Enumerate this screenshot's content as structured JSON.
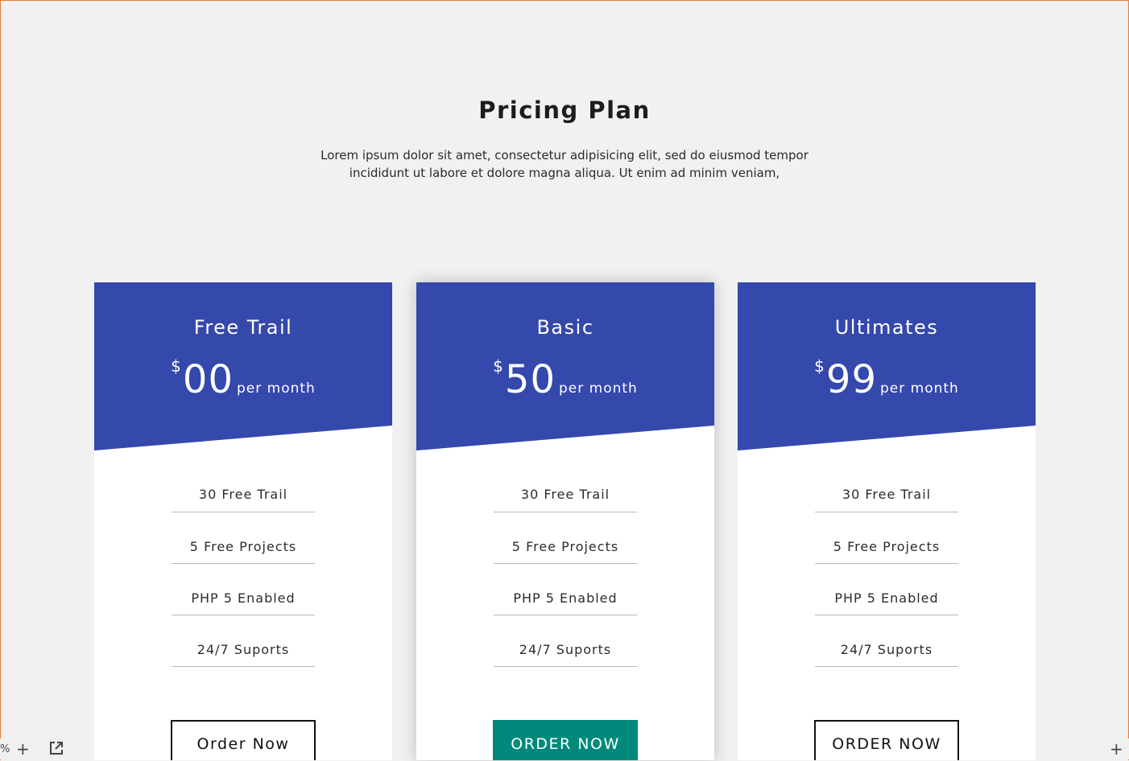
{
  "section": {
    "title": "Pricing Plan",
    "description": "Lorem ipsum dolor sit amet, consectetur adipisicing elit, sed do eiusmod tempor incididunt ut labore et dolore magna aliqua. Ut enim ad minim veniam,"
  },
  "colors": {
    "header_blue": "#3548ac",
    "accent_teal": "#00897b",
    "background": "#f0f1f0",
    "frame_orange": "#e87a3a"
  },
  "plans": [
    {
      "name": "Free Trail",
      "currency": "$",
      "amount": "00",
      "period": "per month",
      "features": [
        "30 Free Trail",
        "5 Free Projects",
        "PHP 5 Enabled",
        "24/7 Suports"
      ],
      "button": "Order Now",
      "featured": false
    },
    {
      "name": "Basic",
      "currency": "$",
      "amount": "50",
      "period": "per month",
      "features": [
        "30 Free Trail",
        "5 Free Projects",
        "PHP 5 Enabled",
        "24/7 Suports"
      ],
      "button": "ORDER NOW",
      "featured": true
    },
    {
      "name": "Ultimates",
      "currency": "$",
      "amount": "99",
      "period": "per month",
      "features": [
        "30 Free Trail",
        "5 Free Projects",
        "PHP 5 Enabled",
        "24/7 Suports"
      ],
      "button": "ORDER NOW",
      "featured": false
    }
  ],
  "toolbar": {
    "zoom_fragment": "%",
    "add_icon": "plus-icon",
    "open_external_icon": "external-link-icon"
  }
}
